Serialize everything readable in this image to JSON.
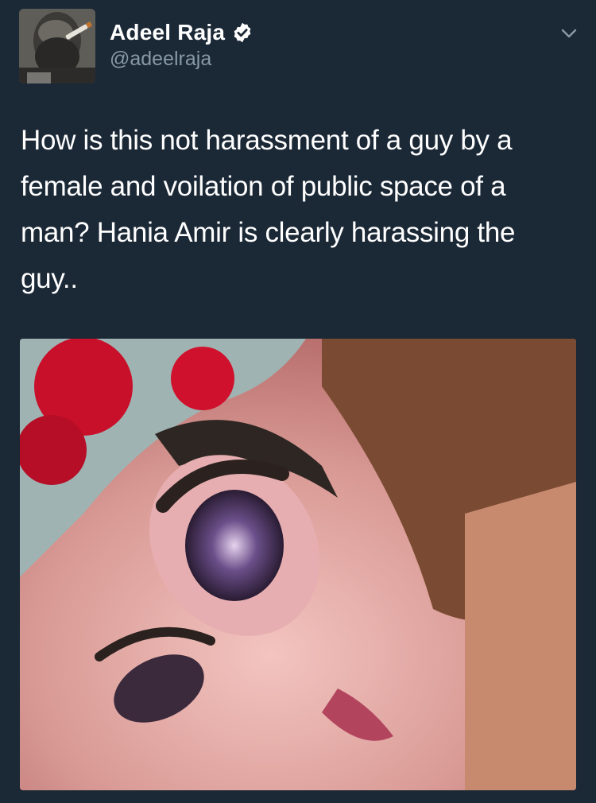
{
  "tweet": {
    "author": {
      "display_name": "Adeel Raja",
      "handle": "@adeelraja",
      "verified": true,
      "verified_icon": "verified-badge-icon"
    },
    "menu_icon": "chevron-down-icon",
    "text": "How is this not harassment of a guy by a female and voilation of public space of a man? Hania Amir is clearly harassing the guy..",
    "media_type": "video-thumbnail"
  },
  "colors": {
    "background": "#1b2836",
    "text_primary": "#ffffff",
    "text_secondary": "#8899a6",
    "verified": "#ffffff"
  }
}
